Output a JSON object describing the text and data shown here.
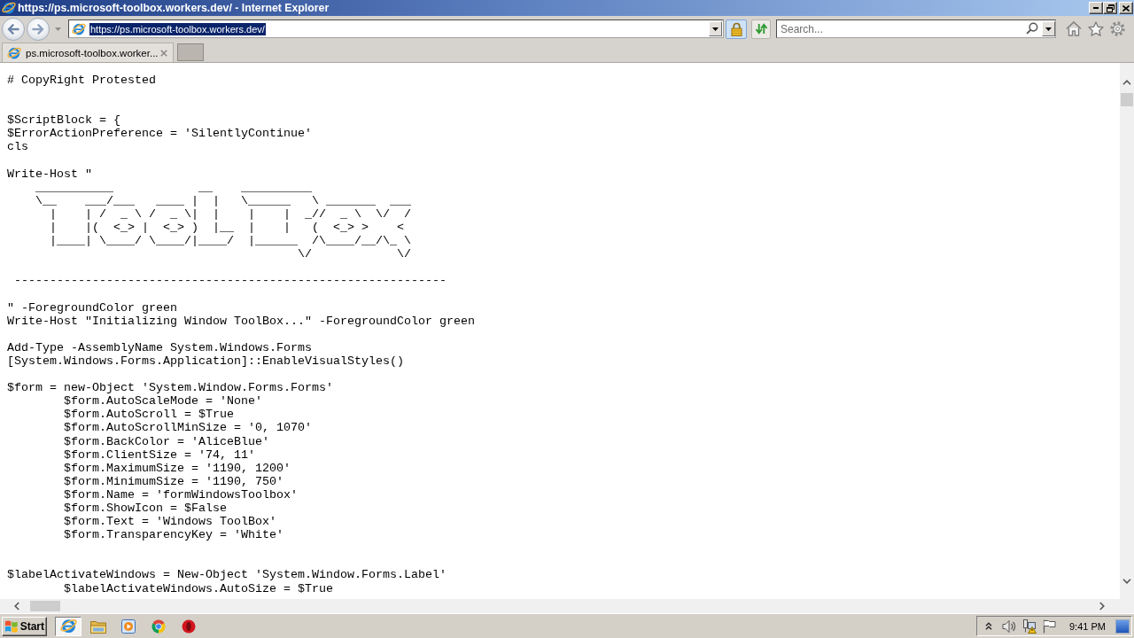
{
  "window": {
    "title": "https://ps.microsoft-toolbox.workers.dev/ - Internet Explorer"
  },
  "address_bar": {
    "url": "https://ps.microsoft-toolbox.workers.dev/",
    "selected": true
  },
  "search": {
    "placeholder": "Search..."
  },
  "tabs": [
    {
      "label": "ps.microsoft-toolbox.worker...",
      "selected": true
    }
  ],
  "document": {
    "lines": [
      {
        "kind": "code",
        "text": "# CopyRight Protested"
      },
      {
        "kind": "blank"
      },
      {
        "kind": "blank"
      },
      {
        "kind": "code",
        "text": "$ScriptBlock = {"
      },
      {
        "kind": "code",
        "text": "$ErrorActionPreference = 'SilentlyContinue'"
      },
      {
        "kind": "code",
        "text": "cls"
      },
      {
        "kind": "blank"
      },
      {
        "kind": "code",
        "text": "Write-Host \""
      },
      {
        "kind": "code",
        "text": "    ___________            __    __________"
      },
      {
        "kind": "code",
        "text": "    \\__    ___/___   ____ |  |   \\______   \\ _______  ___"
      },
      {
        "kind": "code",
        "text": "      |    | /  _ \\ /  _ \\|  |    |    |  _//  _ \\  \\/  /"
      },
      {
        "kind": "code",
        "text": "      |    |(  <_> |  <_> )  |__  |    |   (  <_> >    <"
      },
      {
        "kind": "code",
        "text": "      |____| \\____/ \\____/|____/  |______  /\\____/__/\\_ \\"
      },
      {
        "kind": "code",
        "text": "                                         \\/            \\/"
      },
      {
        "kind": "blank"
      },
      {
        "kind": "code",
        "text": " -------------------------------------------------------------"
      },
      {
        "kind": "blank"
      },
      {
        "kind": "code",
        "text": "\" -ForegroundColor green"
      },
      {
        "kind": "code",
        "text": "Write-Host \"Initializing Window ToolBox...\" -ForegroundColor green"
      },
      {
        "kind": "blank"
      },
      {
        "kind": "code",
        "text": "Add-Type -AssemblyName System.Windows.Forms"
      },
      {
        "kind": "code",
        "text": "[System.Windows.Forms.Application]::EnableVisualStyles()"
      },
      {
        "kind": "blank"
      },
      {
        "kind": "code",
        "text": "$form = new-Object 'System.Window.Forms.Forms'"
      },
      {
        "kind": "code",
        "text": "\t$form.AutoScaleMode = 'None'"
      },
      {
        "kind": "code",
        "text": "\t$form.AutoScroll = $True"
      },
      {
        "kind": "code",
        "text": "\t$form.AutoScrollMinSize = '0, 1070'"
      },
      {
        "kind": "code",
        "text": "\t$form.BackColor = 'AliceBlue'"
      },
      {
        "kind": "code",
        "text": "\t$form.ClientSize = '74, 11'"
      },
      {
        "kind": "code",
        "text": "\t$form.MaximumSize = '1190, 1200'"
      },
      {
        "kind": "code",
        "text": "\t$form.MinimumSize = '1190, 750'"
      },
      {
        "kind": "code",
        "text": "\t$form.Name = 'formWindowsToolbox'"
      },
      {
        "kind": "code",
        "text": "\t$form.ShowIcon = $False"
      },
      {
        "kind": "code",
        "text": "\t$form.Text = 'Windows ToolBox'"
      },
      {
        "kind": "code",
        "text": "\t$form.TransparencyKey = 'White'"
      },
      {
        "kind": "blank"
      },
      {
        "kind": "blank"
      },
      {
        "kind": "code",
        "text": "$labelActivateWindows = New-Object 'System.Window.Forms.Label'"
      },
      {
        "kind": "code",
        "text": "\t$labelActivateWindows.AutoSize = $True"
      }
    ]
  },
  "taskbar": {
    "start_label": "Start",
    "apps": [
      {
        "kind": "browser",
        "selected": true
      },
      {
        "kind": "folder",
        "selected": false
      },
      {
        "kind": "player",
        "selected": false
      },
      {
        "kind": "wheel",
        "selected": false
      },
      {
        "kind": "ring",
        "selected": false
      }
    ],
    "clock": "9:41 PM"
  }
}
